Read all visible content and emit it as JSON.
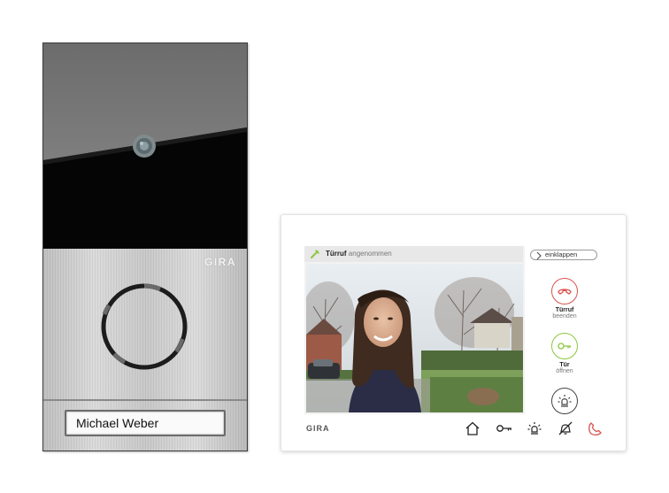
{
  "door_station": {
    "brand": "GIRA",
    "nameplate": "Michael Weber"
  },
  "monitor": {
    "brand": "GIRA",
    "status": {
      "title": "Türruf",
      "subtitle": "angenommen"
    },
    "collapse_label": "einklappen",
    "actions": [
      {
        "line1": "Türruf",
        "line2": "beenden",
        "icon": "hangup-icon",
        "color": "#d9534f"
      },
      {
        "line1": "Tür",
        "line2": "öffnen",
        "icon": "key-icon",
        "color": "#8cc63f"
      },
      {
        "line1": "",
        "line2": "",
        "icon": "light-icon",
        "color": "#444444"
      }
    ],
    "nav_icons": [
      "home-icon",
      "key-icon",
      "light-icon",
      "mute-bell-icon",
      "hangup-icon"
    ]
  }
}
